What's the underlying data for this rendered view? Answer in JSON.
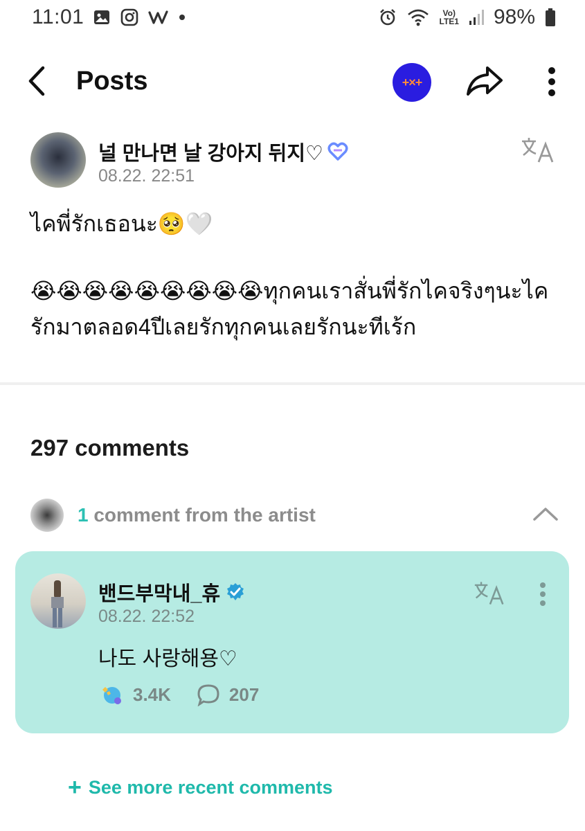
{
  "status_bar": {
    "time": "11:01",
    "battery": "98%",
    "network": "LTE1",
    "left_icons": [
      "gallery-icon",
      "instagram-icon",
      "weverse-icon",
      "dot-icon"
    ],
    "right_icons": [
      "alarm-icon",
      "wifi-icon",
      "signal-icon",
      "battery-icon"
    ]
  },
  "header": {
    "title": "Posts",
    "badge_label": "+×+"
  },
  "post": {
    "author": "널 만나면 날 강아지 뒤지♡",
    "date": "08.22. 22:51",
    "line1": "ไคพี่รักเธอนะ🥺🤍",
    "line2": "😭😭😭😭😭😭😭😭😭ทุกคนเราสั่นพี่รักไคจริงๆนะไค รักมาตลอด4ปีเลยรักทุกคนเลยรักนะทีเร้ก"
  },
  "comments": {
    "count_label": "297 comments",
    "artist_count": "1",
    "artist_label": " comment from the artist",
    "artist_comment": {
      "name": "밴드부막내_휴",
      "date": "08.22. 22:52",
      "text": "나도 사랑해용♡",
      "likes": "3.4K",
      "replies": "207"
    },
    "see_more_label": "See more recent comments"
  },
  "colors": {
    "accent": "#1fb9ab",
    "card_bg": "#b6ebe3",
    "badge_bg": "#2a1de0",
    "badge_fg": "#ff8a3c"
  }
}
